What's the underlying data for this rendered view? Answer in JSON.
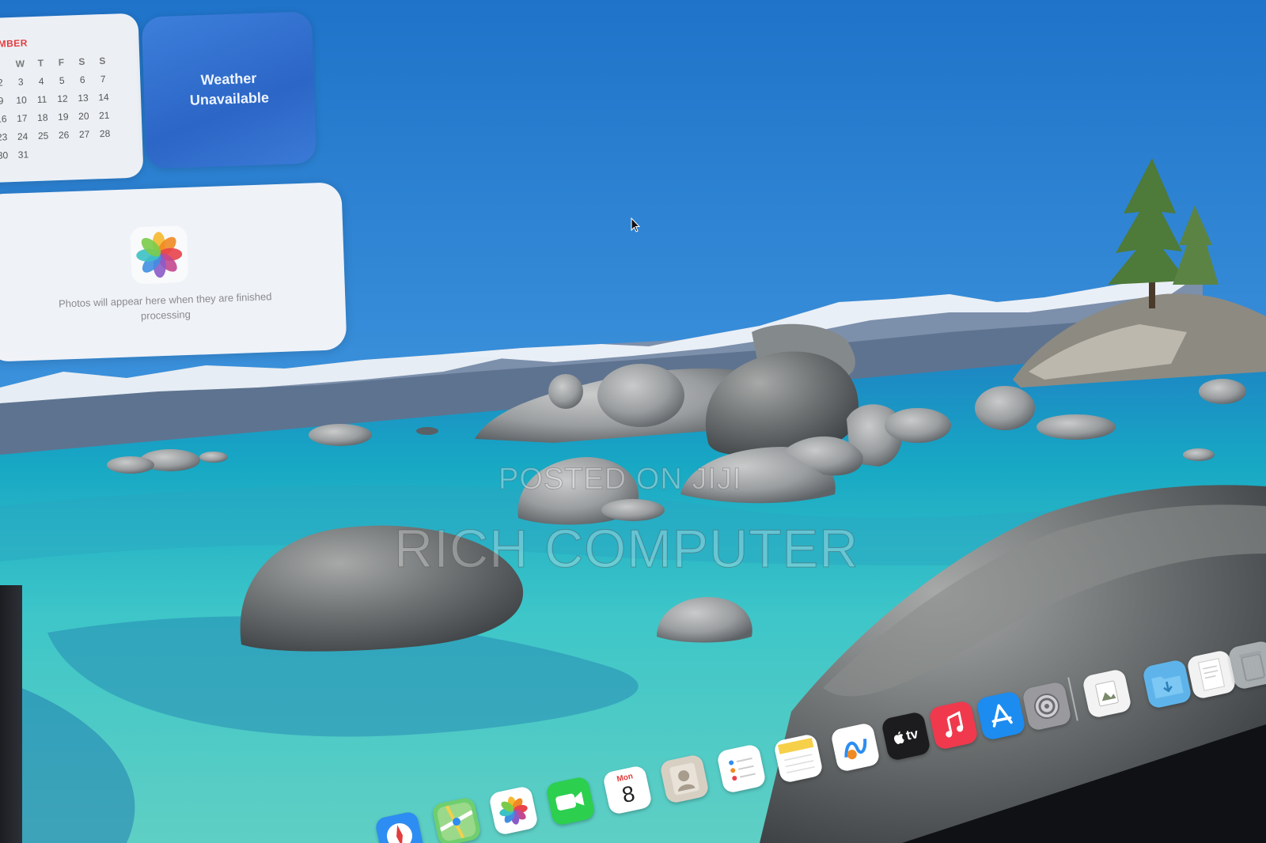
{
  "calendar": {
    "month_fragment": "MBER",
    "weekday_headers": [
      "W",
      "T",
      "F",
      "S",
      "S"
    ],
    "rows": [
      [
        "",
        "3",
        "4",
        "5",
        "6",
        "7"
      ],
      [
        "9",
        "10",
        "11",
        "12",
        "13",
        "14"
      ],
      [
        "16",
        "17",
        "18",
        "19",
        "20",
        "21"
      ],
      [
        "23",
        "24",
        "25",
        "26",
        "27",
        "28"
      ],
      [
        "30",
        "31",
        "",
        "",
        "",
        ""
      ]
    ],
    "row_leading": [
      "2",
      "9",
      "16",
      "23",
      "30"
    ]
  },
  "weather": {
    "line1": "Weather",
    "line2": "Unavailable"
  },
  "photos": {
    "message": "Photos will appear here when they are finished processing"
  },
  "watermark": {
    "line1": "POSTED ON JIJI",
    "line2": "RICH COMPUTER"
  },
  "dock": {
    "calendar_day_label": "Mon",
    "calendar_date": "8",
    "tv_label": "tv",
    "items": [
      "safari-icon",
      "maps-icon",
      "photos-icon",
      "facetime-icon",
      "calendar-icon",
      "contacts-icon",
      "reminders-icon",
      "notes-icon",
      "freeform-icon",
      "apple-tv-icon",
      "music-icon",
      "app-store-icon",
      "system-settings-icon",
      "preview-icon",
      "downloads-folder-icon",
      "document-icon",
      "trash-icon"
    ]
  },
  "colors": {
    "weather_bg": "#2c66c6",
    "calendar_accent": "#e33b3b",
    "music": "#f0394d",
    "app_store": "#1c8cf0",
    "facetime": "#2ccf4e"
  }
}
